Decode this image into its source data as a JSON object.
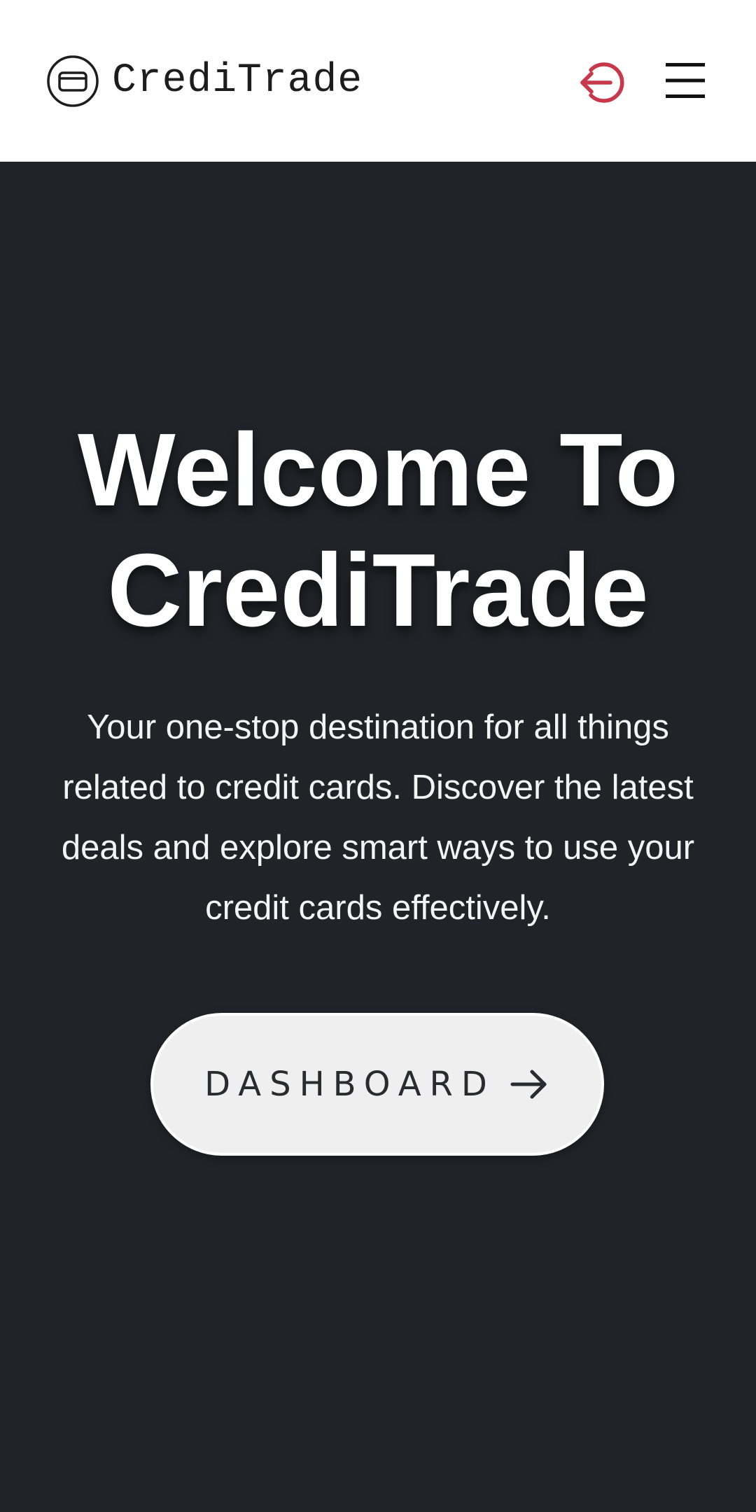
{
  "navbar": {
    "brand_name": "CrediTrade",
    "brand_icon": "credit-card-icon",
    "logout_icon": "logout-icon",
    "menu_icon": "hamburger-menu-icon",
    "logout_color": "#c8374a"
  },
  "hero": {
    "title_line1": "Welcome To",
    "title_line2": "CrediTrade",
    "subtitle": "Your one-stop destination for all things related to credit cards. Discover the latest deals and explore smart ways to use your credit cards effectively.",
    "cta_label": "DASHBOARD",
    "cta_icon": "arrow-right-icon",
    "background_color": "#212329"
  }
}
